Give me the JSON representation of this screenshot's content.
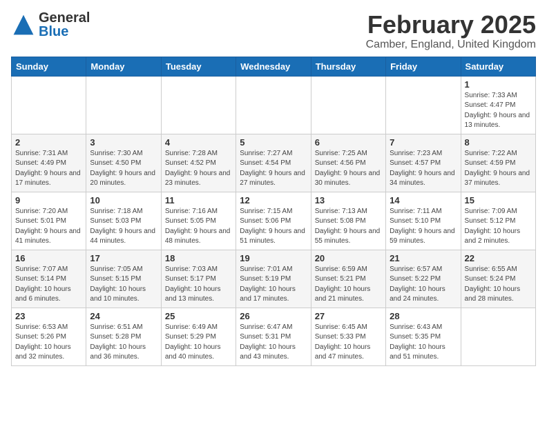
{
  "header": {
    "logo_general": "General",
    "logo_blue": "Blue",
    "month_title": "February 2025",
    "location": "Camber, England, United Kingdom"
  },
  "days_of_week": [
    "Sunday",
    "Monday",
    "Tuesday",
    "Wednesday",
    "Thursday",
    "Friday",
    "Saturday"
  ],
  "weeks": [
    [
      {
        "day": "",
        "info": ""
      },
      {
        "day": "",
        "info": ""
      },
      {
        "day": "",
        "info": ""
      },
      {
        "day": "",
        "info": ""
      },
      {
        "day": "",
        "info": ""
      },
      {
        "day": "",
        "info": ""
      },
      {
        "day": "1",
        "info": "Sunrise: 7:33 AM\nSunset: 4:47 PM\nDaylight: 9 hours\nand 13 minutes."
      }
    ],
    [
      {
        "day": "2",
        "info": "Sunrise: 7:31 AM\nSunset: 4:49 PM\nDaylight: 9 hours\nand 17 minutes."
      },
      {
        "day": "3",
        "info": "Sunrise: 7:30 AM\nSunset: 4:50 PM\nDaylight: 9 hours\nand 20 minutes."
      },
      {
        "day": "4",
        "info": "Sunrise: 7:28 AM\nSunset: 4:52 PM\nDaylight: 9 hours\nand 23 minutes."
      },
      {
        "day": "5",
        "info": "Sunrise: 7:27 AM\nSunset: 4:54 PM\nDaylight: 9 hours\nand 27 minutes."
      },
      {
        "day": "6",
        "info": "Sunrise: 7:25 AM\nSunset: 4:56 PM\nDaylight: 9 hours\nand 30 minutes."
      },
      {
        "day": "7",
        "info": "Sunrise: 7:23 AM\nSunset: 4:57 PM\nDaylight: 9 hours\nand 34 minutes."
      },
      {
        "day": "8",
        "info": "Sunrise: 7:22 AM\nSunset: 4:59 PM\nDaylight: 9 hours\nand 37 minutes."
      }
    ],
    [
      {
        "day": "9",
        "info": "Sunrise: 7:20 AM\nSunset: 5:01 PM\nDaylight: 9 hours\nand 41 minutes."
      },
      {
        "day": "10",
        "info": "Sunrise: 7:18 AM\nSunset: 5:03 PM\nDaylight: 9 hours\nand 44 minutes."
      },
      {
        "day": "11",
        "info": "Sunrise: 7:16 AM\nSunset: 5:05 PM\nDaylight: 9 hours\nand 48 minutes."
      },
      {
        "day": "12",
        "info": "Sunrise: 7:15 AM\nSunset: 5:06 PM\nDaylight: 9 hours\nand 51 minutes."
      },
      {
        "day": "13",
        "info": "Sunrise: 7:13 AM\nSunset: 5:08 PM\nDaylight: 9 hours\nand 55 minutes."
      },
      {
        "day": "14",
        "info": "Sunrise: 7:11 AM\nSunset: 5:10 PM\nDaylight: 9 hours\nand 59 minutes."
      },
      {
        "day": "15",
        "info": "Sunrise: 7:09 AM\nSunset: 5:12 PM\nDaylight: 10 hours\nand 2 minutes."
      }
    ],
    [
      {
        "day": "16",
        "info": "Sunrise: 7:07 AM\nSunset: 5:14 PM\nDaylight: 10 hours\nand 6 minutes."
      },
      {
        "day": "17",
        "info": "Sunrise: 7:05 AM\nSunset: 5:15 PM\nDaylight: 10 hours\nand 10 minutes."
      },
      {
        "day": "18",
        "info": "Sunrise: 7:03 AM\nSunset: 5:17 PM\nDaylight: 10 hours\nand 13 minutes."
      },
      {
        "day": "19",
        "info": "Sunrise: 7:01 AM\nSunset: 5:19 PM\nDaylight: 10 hours\nand 17 minutes."
      },
      {
        "day": "20",
        "info": "Sunrise: 6:59 AM\nSunset: 5:21 PM\nDaylight: 10 hours\nand 21 minutes."
      },
      {
        "day": "21",
        "info": "Sunrise: 6:57 AM\nSunset: 5:22 PM\nDaylight: 10 hours\nand 24 minutes."
      },
      {
        "day": "22",
        "info": "Sunrise: 6:55 AM\nSunset: 5:24 PM\nDaylight: 10 hours\nand 28 minutes."
      }
    ],
    [
      {
        "day": "23",
        "info": "Sunrise: 6:53 AM\nSunset: 5:26 PM\nDaylight: 10 hours\nand 32 minutes."
      },
      {
        "day": "24",
        "info": "Sunrise: 6:51 AM\nSunset: 5:28 PM\nDaylight: 10 hours\nand 36 minutes."
      },
      {
        "day": "25",
        "info": "Sunrise: 6:49 AM\nSunset: 5:29 PM\nDaylight: 10 hours\nand 40 minutes."
      },
      {
        "day": "26",
        "info": "Sunrise: 6:47 AM\nSunset: 5:31 PM\nDaylight: 10 hours\nand 43 minutes."
      },
      {
        "day": "27",
        "info": "Sunrise: 6:45 AM\nSunset: 5:33 PM\nDaylight: 10 hours\nand 47 minutes."
      },
      {
        "day": "28",
        "info": "Sunrise: 6:43 AM\nSunset: 5:35 PM\nDaylight: 10 hours\nand 51 minutes."
      },
      {
        "day": "",
        "info": ""
      }
    ]
  ]
}
